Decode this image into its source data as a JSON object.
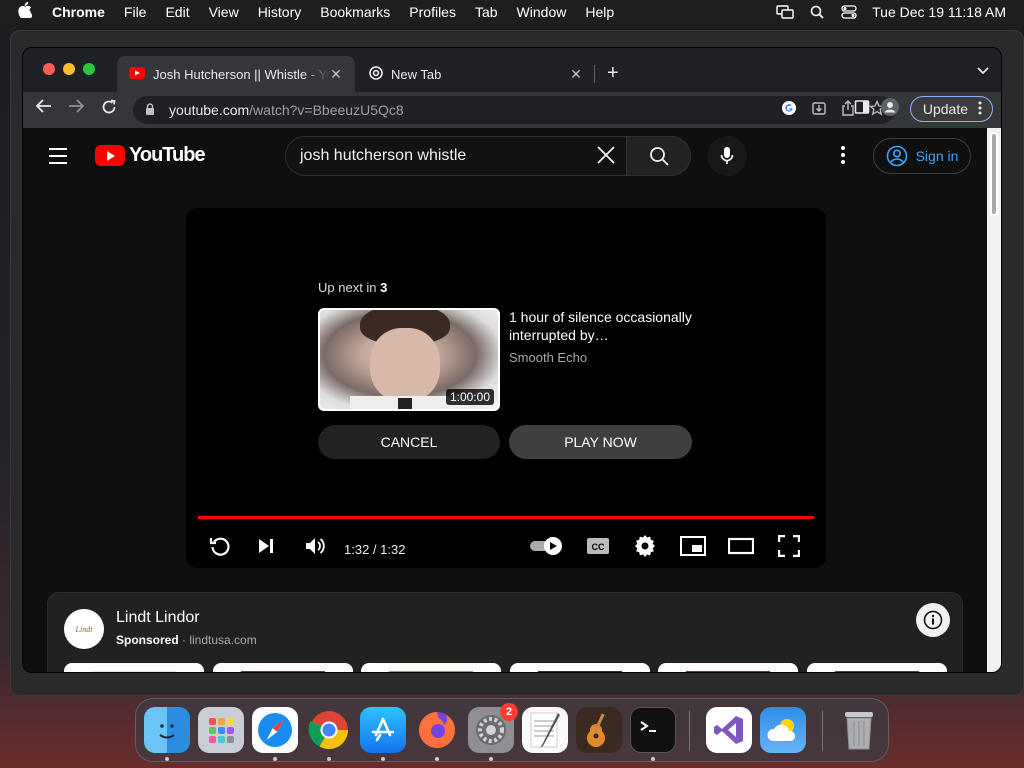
{
  "menubar": {
    "app": "Chrome",
    "items": [
      "File",
      "Edit",
      "View",
      "History",
      "Bookmarks",
      "Profiles",
      "Tab",
      "Window",
      "Help"
    ],
    "clock": "Tue Dec 19  11:18 AM"
  },
  "browser": {
    "tabs": [
      {
        "title": "Josh Hutcherson || Whistle - YouTube",
        "icon": "youtube-icon",
        "active": true
      },
      {
        "title": "New Tab",
        "icon": "chrome-icon",
        "active": false
      }
    ],
    "url": {
      "host": "youtube.com",
      "path": "/watch?v=BbeeuzU5Qc8"
    },
    "update_label": "Update"
  },
  "youtube": {
    "logo_text": "YouTube",
    "search_value": "josh hutcherson whistle",
    "sign_in": "Sign in",
    "player": {
      "up_next_prefix": "Up next in",
      "countdown": "3",
      "next_title": "1 hour of silence occasionally interrupted by…",
      "next_channel": "Smooth Echo",
      "next_duration": "1:00:00",
      "cancel_label": "CANCEL",
      "play_now_label": "PLAY NOW",
      "time": "1:32 / 1:32",
      "progress": 1.0,
      "progress_color": "#ff0000"
    },
    "ad": {
      "brand": "Lindt Lindor",
      "sponsored": "Sponsored",
      "domain": "lindtusa.com",
      "logo_text": "Lindt"
    }
  },
  "dock": {
    "apps": [
      "Finder",
      "Launchpad",
      "Safari",
      "Chrome",
      "App Store",
      "Firefox",
      "System Settings",
      "TextEdit",
      "GarageBand",
      "Terminal",
      "Visual Studio",
      "Weather",
      "Trash"
    ],
    "settings_badge": "2"
  }
}
